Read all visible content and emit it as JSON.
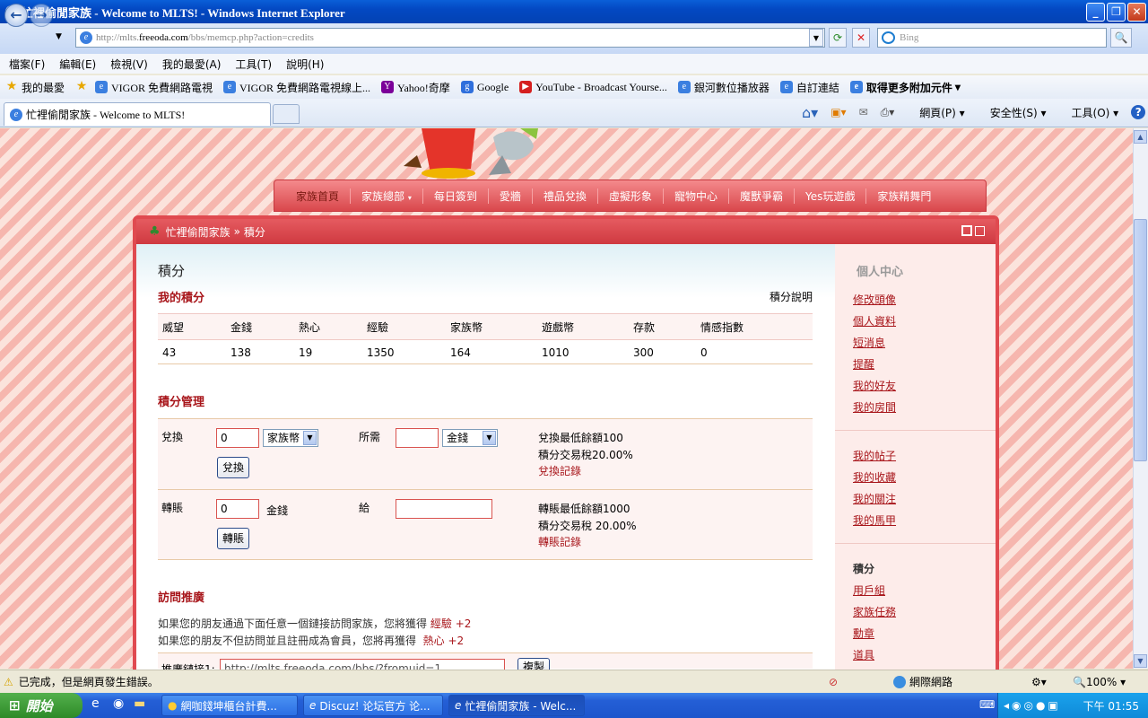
{
  "window": {
    "title": "忙裡偷閒家族 - Welcome to MLTS! - Windows Internet Explorer"
  },
  "address": {
    "url_prefix": "http://mlts.",
    "url_domain": "freeoda.com",
    "url_path": "/bbs/memcp.php?action=credits"
  },
  "search": {
    "placeholder": "Bing"
  },
  "menu": [
    "檔案(F)",
    "編輯(E)",
    "檢視(V)",
    "我的最愛(A)",
    "工具(T)",
    "說明(H)"
  ],
  "favorites": {
    "label": "我的最愛",
    "items": [
      "VIGOR 免費網路電視",
      "VIGOR 免費網路電視線上...",
      "Yahoo!奇摩",
      "Google",
      "YouTube - Broadcast Yourse...",
      "銀河數位播放器",
      "自訂連結",
      "取得更多附加元件"
    ]
  },
  "tab": {
    "label": "忙裡偷閒家族 - Welcome to MLTS!"
  },
  "command_bar": [
    "網頁(P)",
    "安全性(S)",
    "工具(O)"
  ],
  "site_nav": [
    "家族首頁",
    "家族總部",
    "每日簽到",
    "愛牆",
    "禮品兌換",
    "虛擬形象",
    "寵物中心",
    "魔獸爭霸",
    "Yes玩遊戲",
    "家族精舞門"
  ],
  "breadcrumb": {
    "home": "忙裡偷閒家族",
    "sep": "»",
    "current": "積分"
  },
  "page": {
    "title": "積分",
    "my_credits_heading": "我的積分",
    "credits_help": "積分說明",
    "credits_table": {
      "headers": [
        "威望",
        "金錢",
        "熱心",
        "經驗",
        "家族幣",
        "遊戲幣",
        "存款",
        "情感指數"
      ],
      "values": [
        "43",
        "138",
        "19",
        "1350",
        "164",
        "1010",
        "300",
        "0"
      ]
    },
    "manage_heading": "積分管理",
    "exchange": {
      "label": "兌換",
      "amount": "0",
      "from_currency": "家族幣",
      "need_label": "所需",
      "need_value": "",
      "to_currency": "金錢",
      "button": "兌換",
      "info_min": "兌換最低餘額100",
      "info_tax": "積分交易稅20.00%",
      "record_link": "兌換記錄"
    },
    "transfer": {
      "label": "轉賬",
      "amount": "0",
      "currency": "金錢",
      "to_label": "給",
      "to_value": "",
      "button": "轉賬",
      "info_min": "轉賬最低餘額1000",
      "info_tax": "積分交易稅 20.00%",
      "record_link": "轉賬記錄"
    },
    "visit_heading": "訪問推廣",
    "visit_line1": "如果您的朋友通過下面任意一個鏈接訪問家族，您將獲得",
    "visit_bonus1_label": "經驗",
    "visit_bonus1_value": "+2",
    "visit_line2": "如果您的朋友不但訪問並且註冊成為會員，您將再獲得",
    "visit_bonus2_label": "熱心",
    "visit_bonus2_value": "+2",
    "referral_label": "推廣鏈接1:",
    "referral_value": "http://mlts.freeoda.com/bbs/?fromuid=1",
    "copy_button": "複製"
  },
  "sidebar": {
    "title": "個人中心",
    "group1": [
      "修改頭像",
      "個人資料",
      "短消息",
      "提醒",
      "我的好友",
      "我的房間"
    ],
    "group2": [
      "我的帖子",
      "我的收藏",
      "我的關注",
      "我的馬甲"
    ],
    "group3_title": "積分",
    "group3": [
      "用戶組",
      "家族任務",
      "勳章",
      "道具"
    ]
  },
  "status": {
    "text": "已完成，但是網頁發生錯誤。",
    "zone": "網際網路",
    "zoom": "100%"
  },
  "taskbar": {
    "start": "開始",
    "tasks": [
      "網咖錢坤櫃台計費...",
      "Discuz! 论坛官方 论...",
      "忙裡偷閒家族 - Welc..."
    ],
    "clock": "下午 01:55"
  }
}
